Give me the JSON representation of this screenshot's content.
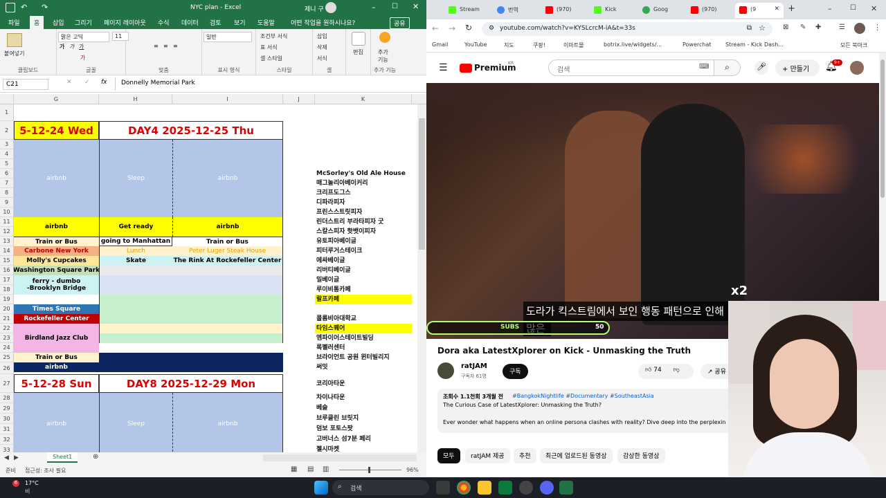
{
  "excel": {
    "title": "NYC plan  -  Excel",
    "user": "제니 구",
    "share": "공유",
    "tabs": [
      "파일",
      "홈",
      "삽입",
      "그리기",
      "페이지 레이아웃",
      "수식",
      "데이터",
      "검토",
      "보기",
      "도움말",
      "어떤 작업을 원하시나요?"
    ],
    "ribbon": {
      "paste": "붙여넣기",
      "clipboard": "클립보드",
      "font_name": "맑은 고딕",
      "font_size": "11",
      "font_group": "글꼴",
      "align_group": "맞춤",
      "number_format": "일반",
      "number_group": "표시 형식",
      "cond_format": "조건부 서식",
      "table_format": "표 서식",
      "cell_style": "셀 스타일",
      "style_group": "스타일",
      "insert": "삽입",
      "delete": "삭제",
      "format": "서식",
      "cells_group": "셀",
      "edit": "편집",
      "addin": "추가 기능",
      "addin_group": "추가 기능"
    },
    "formula": {
      "cell_ref": "C21",
      "content": "Donnelly Memorial Park"
    },
    "columns": [
      "G",
      "H",
      "I",
      "J",
      "K"
    ],
    "rows": [
      "1",
      "2",
      "3",
      "4",
      "5",
      "6",
      "7",
      "8",
      "9",
      "10",
      "11",
      "12",
      "13",
      "14",
      "15",
      "16",
      "17",
      "18",
      "19",
      "20",
      "21",
      "22",
      "23",
      "24",
      "25",
      "26",
      "27",
      "28",
      "29",
      "30",
      "31",
      "32",
      "33"
    ],
    "day_headers": [
      "5-12-24 Wed",
      "DAY4  2025-12-25 Thu",
      "5-12-28 Sun",
      "DAY8  2025-12-29 Mon"
    ],
    "cells": {
      "airbnb": "airbnb",
      "sleep": "Sleep",
      "get_ready": "Get ready",
      "train_bus": "Train or Bus",
      "going_manhattan": "going to Manhattan",
      "carbone": "Carbone New York",
      "lunch": "Lunch",
      "peter_luger": "Peter Luger Steak House",
      "mollys": "Molly's Cupcakes",
      "skate": "Skate",
      "rink": "The Rink At Rockefeller Center",
      "washington": "Washington Square Park",
      "ferry": "ferry - dumbo",
      "brooklyn": "-Brooklyn Bridge",
      "times_square": "Times Square",
      "rockefeller": "Rockefeller Center",
      "birdland": "Birdland Jazz Club"
    },
    "k_list": [
      "McSorley's Old Ale House",
      "매그놀리아베이커리",
      "크리프도그스",
      "디파라피자",
      "프린스스트릿피자",
      "린더스트리 부라타피자 굿",
      "스칼스피자 핫뱃이피자",
      "유토피아베이글",
      "피터루거스테이크",
      "에싸베이글",
      "리버티베이글",
      "밀베이글",
      "루이비통카페",
      "랄프카페",
      "콜롬비아대학교",
      "타임스퀘어",
      "엠파이어스테이트빌딩",
      "록펠러센터",
      "브라이언트 공원 윈터빌리지",
      "써밋",
      "코리아타운",
      "차이나타운",
      "베슬",
      "브루클린 브릿지",
      "덤보 포토스팟",
      "고버너스 섬7분 페리",
      "첼시마켓"
    ],
    "sheet_tab": "Sheet1",
    "status_left": "준비",
    "status_access": "접근성: 조사 필요",
    "zoom": "96%"
  },
  "chrome": {
    "tabs": [
      "Stream",
      "번역",
      "(970)",
      "Kick",
      "Goog",
      "(970)",
      "(9"
    ],
    "url": "youtube.com/watch?v=KYSLcrcM-iA&t=33s",
    "bookmarks": [
      "Gmail",
      "YouTube",
      "지도",
      "쿠팡!",
      "이마트몰",
      "botrix.live/widgets/...",
      "Powerchat",
      "Stream - Kick Dash...",
      "모든 북마크"
    ]
  },
  "youtube": {
    "logo": "Premium",
    "logo_region": "KR",
    "search_placeholder": "검색",
    "create": "만들기",
    "notif_count": "9+",
    "caption1": "도라가 킥스트림에서 보인 행동 패턴으로 인해",
    "caption2": "많은",
    "subs_label": "SUBS",
    "subs_value": "50",
    "multiplier": "x2",
    "video_title": "Dora aka LatestXplorer on Kick - Unmasking the Truth",
    "channel": "ratJAM",
    "subscribers": "구독자 61명",
    "subscribe": "구독",
    "likes": "74",
    "share": "공유",
    "views": "조회수 1.1천회  3개월 전",
    "hashtags": "#BangkokNightlife #Documentary #SoutheastAsia",
    "desc1": "The Curious Case of LatestXplorer: Unmasking the Truth?",
    "desc2": "Ever wonder what happens when an online persona clashes with reality? Dive deep into the perplexin",
    "chips": [
      "모두",
      "ratJAM 제공",
      "추천",
      "최근에 업로드된 동영상",
      "감상한 동영상"
    ]
  },
  "taskbar": {
    "temp": "17°C",
    "weather": "비",
    "weather_badge": "6",
    "search": "검색"
  },
  "colors": {
    "excel_green": "#217346",
    "yellow": "#ffff00",
    "blue_block": "#b4c6e7",
    "red_text": "#e00000",
    "navy": "#0b2660",
    "youtube_red": "#ff0000"
  }
}
